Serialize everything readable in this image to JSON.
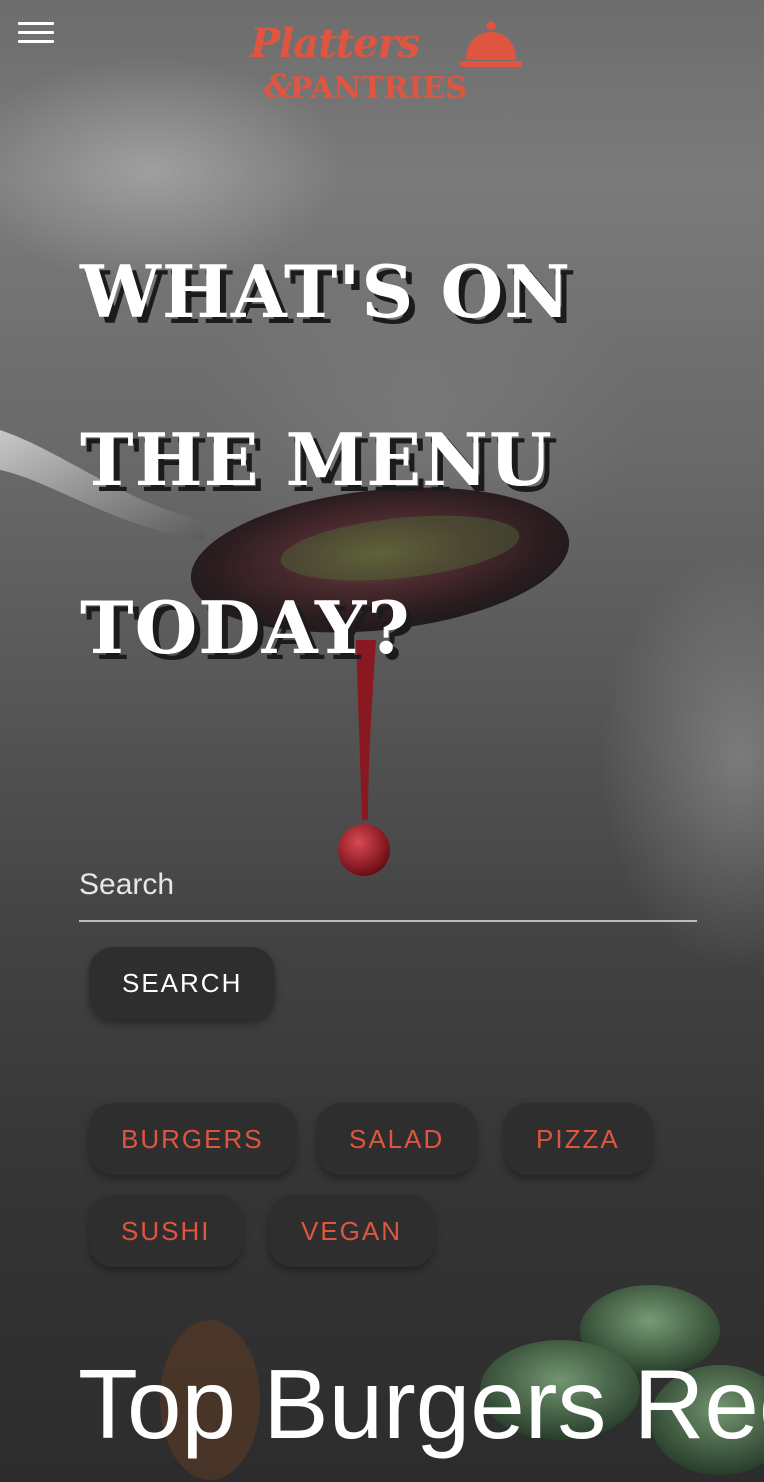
{
  "header": {
    "menu_icon": "hamburger-menu-icon",
    "logo": {
      "line1": "Platters",
      "amp": "&",
      "line2": "PANTRIES",
      "icon": "serving-cloche-icon",
      "color": "#e0553f"
    }
  },
  "hero": {
    "title": "WHAT'S ON\nTHE MENU\nTODAY?"
  },
  "search": {
    "placeholder": "Search",
    "value": "",
    "button_label": "SEARCH"
  },
  "categories": [
    {
      "label": "BURGERS"
    },
    {
      "label": "SALAD"
    },
    {
      "label": "PIZZA"
    },
    {
      "label": "SUSHI"
    },
    {
      "label": "VEGAN"
    }
  ],
  "section": {
    "title": "Top Burgers Recipes"
  },
  "colors": {
    "accent": "#e0553f",
    "chip_background": "#2e2e2e",
    "text": "#ffffff"
  }
}
